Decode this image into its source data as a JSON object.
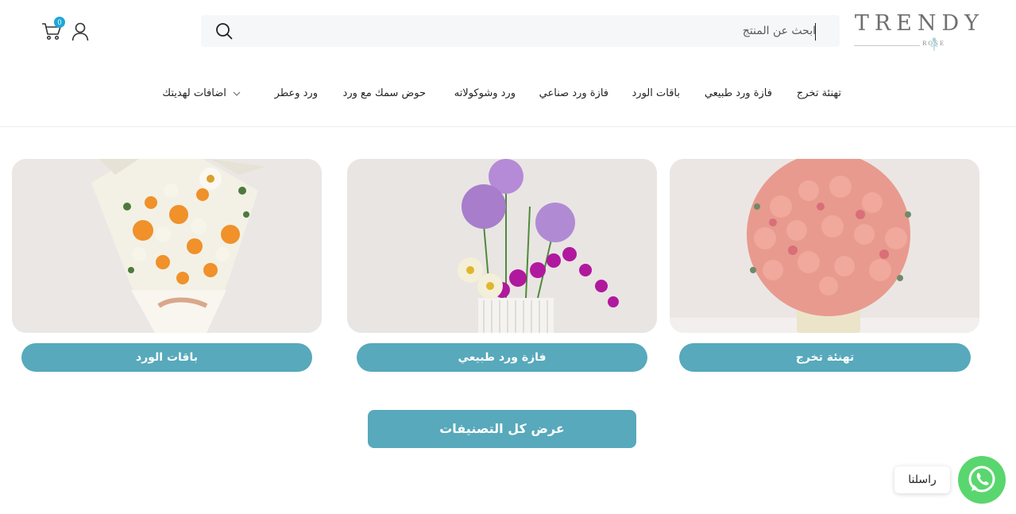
{
  "brand": {
    "name": "TRENDY",
    "sub": "ROSE"
  },
  "search": {
    "placeholder": "ابحث عن المنتج"
  },
  "cart": {
    "count": "0"
  },
  "nav": {
    "items": [
      "تهنئة تخرج",
      "فازة ورد طبيعي",
      "باقات الورد",
      "فازة ورد صناعي",
      "ورد وشوكولاته",
      "حوض سمك مع ورد",
      "ورد وعطر",
      "اضافات لهديتك"
    ]
  },
  "categories": [
    {
      "label": "تهنئة تخرج",
      "image": "pink-rose-vase"
    },
    {
      "label": "فازة ورد طبيعي",
      "image": "purple-orchid-arrangement"
    },
    {
      "label": "باقات الورد",
      "image": "orange-white-bouquet"
    }
  ],
  "view_all": "عرض كل التصنيفات",
  "whatsapp": {
    "label": "راسلنا",
    "icon": "whatsapp-icon"
  },
  "colors": {
    "accent": "#57a9bb",
    "whatsapp": "#5ad66e",
    "badge": "#1ea7d8"
  }
}
